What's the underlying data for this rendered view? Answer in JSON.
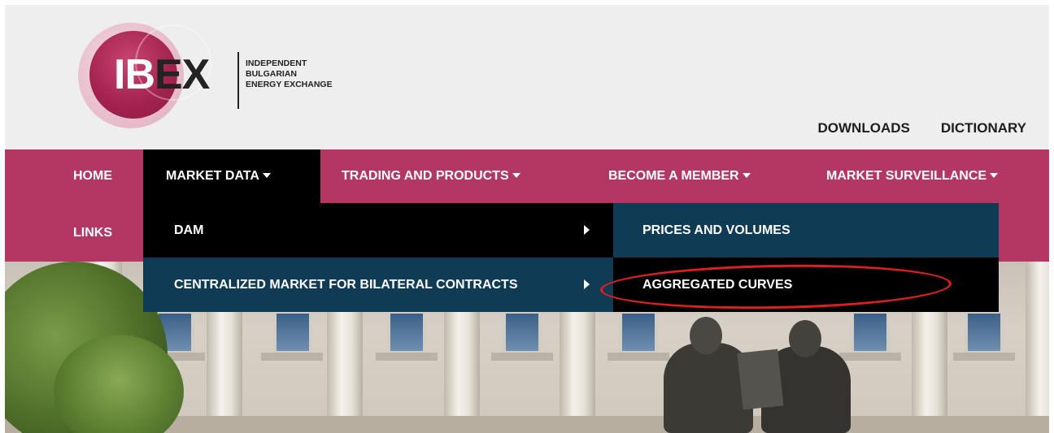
{
  "logo": {
    "mark_part1": "IB",
    "mark_part2": "EX",
    "subtitle_line1": "INDEPENDENT",
    "subtitle_line2": "BULGARIAN",
    "subtitle_line3": "ENERGY EXCHANGE"
  },
  "top_links": {
    "downloads": "DOWNLOADS",
    "dictionary": "DICTIONARY"
  },
  "nav": {
    "home": "HOME",
    "market_data": "MARKET DATA",
    "trading_and_products": "TRADING AND PRODUCTS",
    "become_a_member": "BECOME A MEMBER",
    "market_surveillance": "MARKET SURVEILLANCE",
    "links": "LINKS",
    "active": "MARKET DATA"
  },
  "market_data_menu": {
    "items": [
      "DAM",
      "CENTRALIZED MARKET FOR BILATERAL CONTRACTS"
    ]
  },
  "dam_submenu": {
    "items": [
      "PRICES AND VOLUMES",
      "AGGREGATED CURVES"
    ],
    "highlighted": "AGGREGATED CURVES"
  },
  "colors": {
    "brand": "#b23762",
    "menu_dark": "#000000",
    "menu_blue": "#0f3b55",
    "highlight": "#e01f1f",
    "header_bg": "#eeeeee"
  },
  "icons": [
    "caret-down-icon",
    "chevron-right-icon"
  ]
}
